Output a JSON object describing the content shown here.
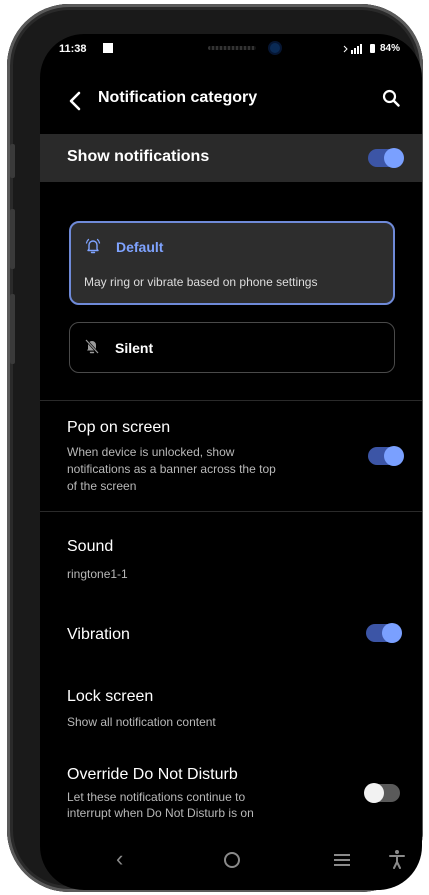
{
  "status_bar": {
    "time": "11:38",
    "battery": "84%",
    "signal_icon": "signal-icon"
  },
  "app_bar": {
    "title": "Notification category",
    "back_icon": "back-arrow-icon",
    "search_icon": "search-icon"
  },
  "show_notifications": {
    "label": "Show notifications",
    "enabled": true
  },
  "options": {
    "default": {
      "title": "Default",
      "description": "May ring or vibrate based on phone settings",
      "icon": "bell-ring-icon",
      "selected": true
    },
    "silent": {
      "title": "Silent",
      "icon": "bell-off-icon",
      "selected": false
    }
  },
  "settings": {
    "pop_on_screen": {
      "title": "Pop on screen",
      "line1": "When device is unlocked, show",
      "line2": "notifications as a banner across the top",
      "line3": "of the screen",
      "enabled": true
    },
    "sound": {
      "title": "Sound",
      "value": "ringtone1-1"
    },
    "vibration": {
      "title": "Vibration",
      "enabled": true
    },
    "lock_screen": {
      "title": "Lock screen",
      "value": "Show all notification content"
    },
    "override_dnd": {
      "title": "Override Do Not Disturb",
      "line1": "Let these notifications continue to",
      "line2": "interrupt when Do Not Disturb is on",
      "enabled": false
    }
  },
  "nav_bar": {
    "back": "‹",
    "home_icon": "home-icon",
    "recents_icon": "recents-icon",
    "accessibility_icon": "accessibility-icon"
  },
  "colors": {
    "accent": "#7fa3ff",
    "toggle_on": "#3c55a6",
    "card_bg": "#2d2d2d",
    "background": "#000000"
  }
}
